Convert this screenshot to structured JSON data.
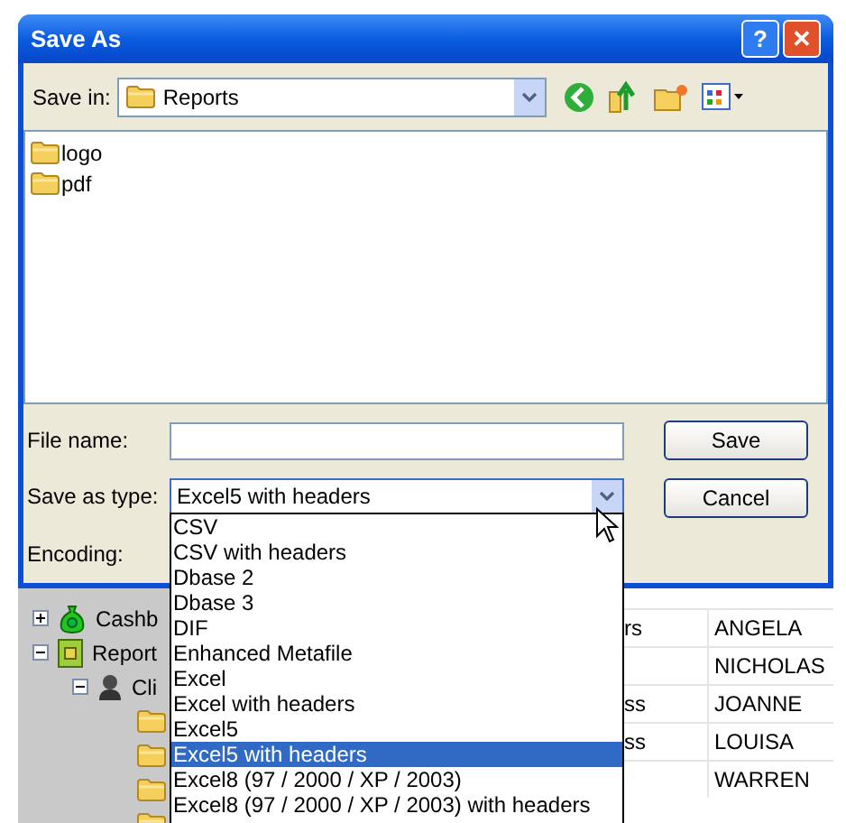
{
  "window": {
    "title": "Save As",
    "title_buttons": [
      {
        "kind": "help",
        "label": "?"
      },
      {
        "kind": "close",
        "label": "✕"
      }
    ]
  },
  "save_in": {
    "label": "Save in:",
    "value": "Reports"
  },
  "files": [
    {
      "name": "logo"
    },
    {
      "name": "pdf"
    }
  ],
  "file_name": {
    "label": "File name:"
  },
  "save_as_type": {
    "label": "Save as type:",
    "value": "Excel5 with headers",
    "expanded": true,
    "options": [
      {
        "label": "CSV",
        "selected": false
      },
      {
        "label": "CSV with headers",
        "selected": false
      },
      {
        "label": "Dbase 2",
        "selected": false
      },
      {
        "label": "Dbase 3",
        "selected": false
      },
      {
        "label": "DIF",
        "selected": false
      },
      {
        "label": "Enhanced Metafile",
        "selected": false
      },
      {
        "label": "Excel",
        "selected": false
      },
      {
        "label": "Excel with headers",
        "selected": false
      },
      {
        "label": "Excel5",
        "selected": false
      },
      {
        "label": "Excel5 with headers",
        "selected": true
      },
      {
        "label": "Excel8 (97 / 2000 / XP / 2003)",
        "selected": false
      },
      {
        "label": "Excel8 (97 / 2000 / XP / 2003) with headers",
        "selected": false
      }
    ]
  },
  "encoding": {
    "label": "Encoding:"
  },
  "buttons": [
    "Save",
    "Cancel"
  ],
  "background": {
    "tree": [
      {
        "label": "Cashb",
        "kind": "money",
        "expanded": false
      },
      {
        "label": "Report",
        "kind": "report",
        "expanded": true,
        "children": [
          {
            "label": "Cli",
            "kind": "person",
            "expanded": true,
            "children": [
              {
                "kind": "folder"
              },
              {
                "kind": "folder"
              },
              {
                "kind": "folder"
              },
              {
                "kind": "folder"
              }
            ]
          }
        ]
      }
    ],
    "table_rows": [
      {
        "column_1": "rs",
        "column_2": "ANGELA"
      },
      {
        "column_2": "NICHOLAS"
      },
      {
        "column_1": "ss",
        "column_2": "JOANNE"
      },
      {
        "column_1": "ss",
        "column_2": "LOUISA"
      },
      {
        "column_2": "WARREN"
      }
    ]
  }
}
